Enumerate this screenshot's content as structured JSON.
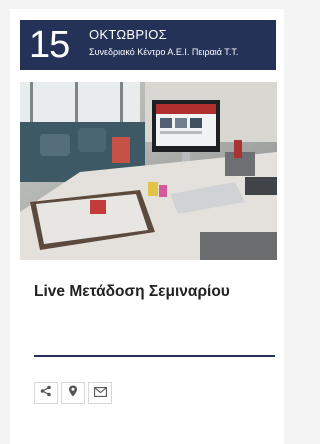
{
  "event": {
    "day": "15",
    "month": "ΟΚΤΩΒΡΙΟΣ",
    "venue": "Συνεδριακό Κέντρο Α.Ε.Ι. Πειραιά Τ.Τ.",
    "title": "Live Μετάδοση Σεμιναρίου"
  },
  "actions": [
    {
      "icon": "share-icon"
    },
    {
      "icon": "location-pin-icon"
    },
    {
      "icon": "envelope-icon"
    }
  ],
  "colors": {
    "accent": "#233256",
    "title": "#222222",
    "icon": "#555555"
  }
}
